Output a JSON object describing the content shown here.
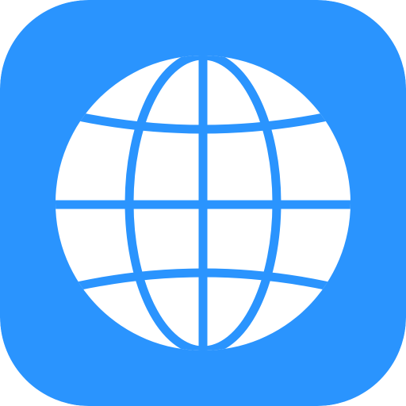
{
  "app_icon": {
    "icon": "globe-icon",
    "colors": {
      "background": "#2a94fe",
      "globe": "#ffffff"
    }
  }
}
